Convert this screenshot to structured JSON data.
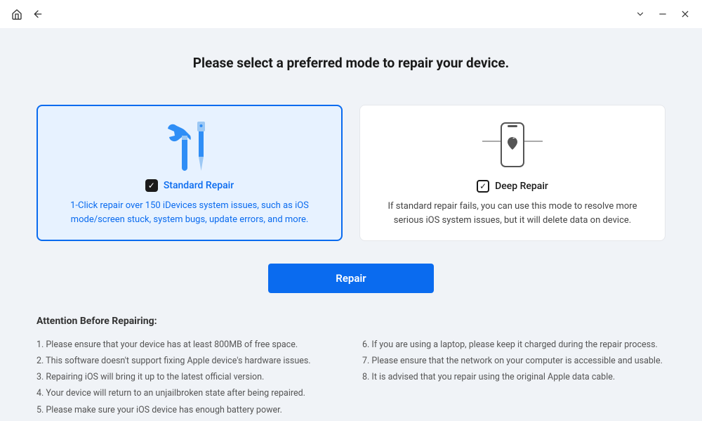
{
  "heading": "Please select a preferred mode to repair your device.",
  "cards": {
    "standard": {
      "title": "Standard Repair",
      "desc": "1-Click repair over 150 iDevices system issues, such as iOS mode/screen stuck, system bugs, update errors, and more."
    },
    "deep": {
      "title": "Deep Repair",
      "desc": "If standard repair fails, you can use this mode to resolve more serious iOS system issues, but it will delete data on device."
    }
  },
  "repair_button": "Repair",
  "attention": {
    "title": "Attention Before Repairing:",
    "left": [
      "1. Please ensure that your device has at least 800MB of free space.",
      "2. This software doesn't support fixing Apple device's hardware issues.",
      "3. Repairing iOS will bring it up to the latest official version.",
      "4. Your device will return to an unjailbroken state after being repaired.",
      "5. Please make sure your iOS device has enough battery power."
    ],
    "right": [
      "6. If you are using a laptop, please keep it charged during the repair process.",
      "7. Please ensure that the network on your computer is accessible and usable.",
      "8. It is advised that you repair using the original Apple data cable."
    ]
  }
}
